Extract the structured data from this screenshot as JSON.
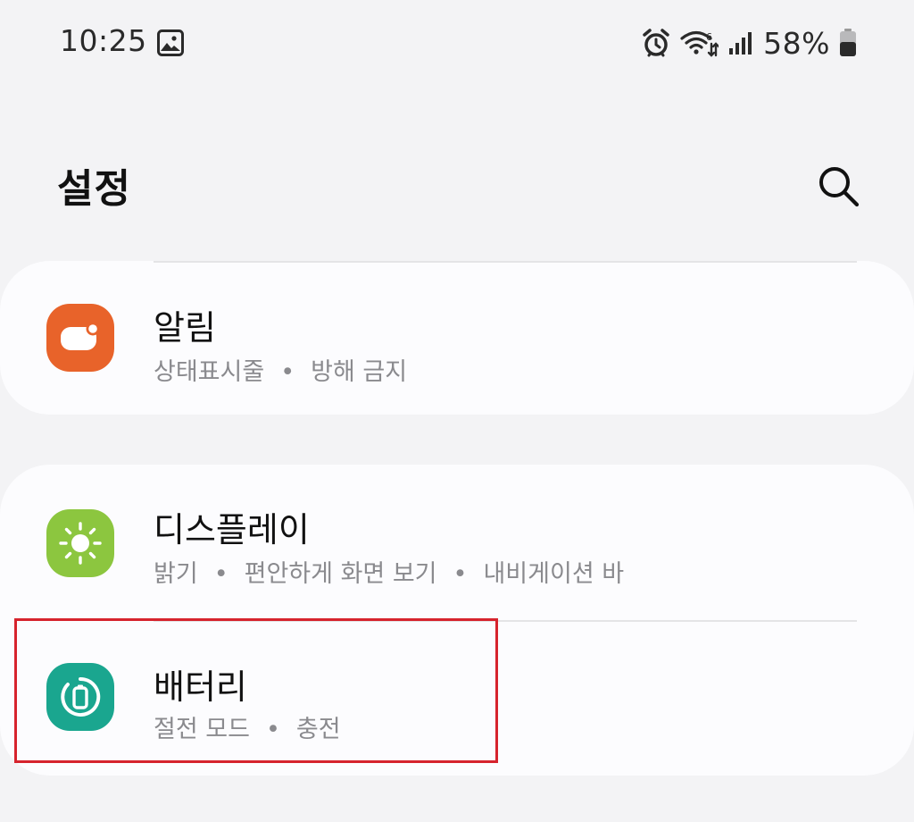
{
  "status_bar": {
    "time": "10:25",
    "battery_percent": "58%",
    "icons": [
      "gallery-icon",
      "alarm-icon",
      "wifi-icon",
      "signal-icon",
      "battery-icon"
    ]
  },
  "header": {
    "title": "설정",
    "search_icon": "search-icon"
  },
  "settings": [
    {
      "title": "알림",
      "subtitle_parts": [
        "상태표시줄",
        "방해 금지"
      ],
      "icon": "notifications-icon",
      "icon_color": "#e8632a"
    },
    {
      "title": "디스플레이",
      "subtitle_parts": [
        "밝기",
        "편안하게 화면 보기",
        "내비게이션 바"
      ],
      "icon": "display-sun-icon",
      "icon_color": "#8cc63f"
    },
    {
      "title": "배터리",
      "subtitle_parts": [
        "절전 모드",
        "충전"
      ],
      "icon": "battery-care-icon",
      "icon_color": "#1aa68f"
    }
  ],
  "separator": "•",
  "highlight_color": "#d6232d"
}
